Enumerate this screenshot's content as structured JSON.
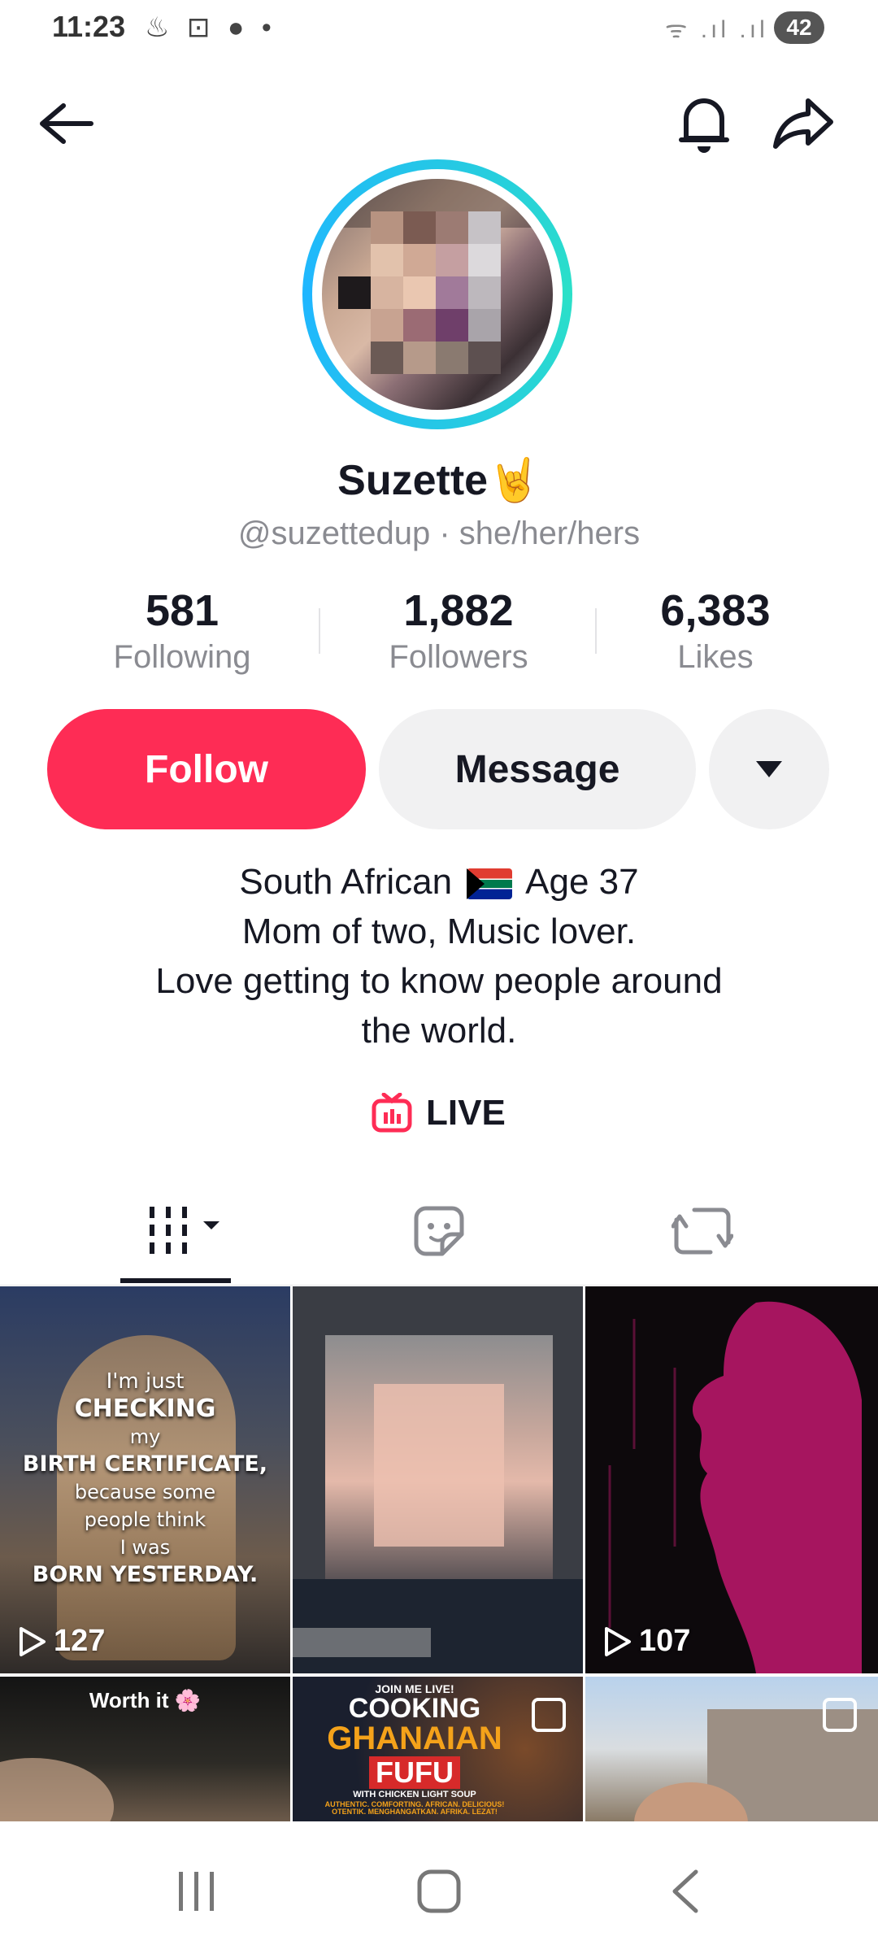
{
  "status_bar": {
    "time": "11:23",
    "icons": "♨ ⊡ ● •",
    "signal": "ᯤ .ıl .ıl",
    "battery": "42"
  },
  "header": {
    "back_icon": "arrow-left",
    "bell_icon": "bell",
    "share_icon": "share-arrow"
  },
  "profile": {
    "display_name": "Suzette",
    "emoji": "🤘",
    "handle": "@suzettedup · she/her/hers",
    "stats": [
      {
        "value": "581",
        "label": "Following"
      },
      {
        "value": "1,882",
        "label": "Followers"
      },
      {
        "value": "6,383",
        "label": "Likes"
      }
    ]
  },
  "actions": {
    "follow": "Follow",
    "message": "Message"
  },
  "bio": {
    "line1_a": "South African",
    "line1_b": "Age 37",
    "line2": "Mom of two, Music lover.",
    "line3": "Love getting to know people around",
    "line4": "the world."
  },
  "live_label": "LIVE",
  "grid": [
    {
      "overlay": [
        "I'm just",
        "CHECKING",
        "my",
        "BIRTH CERTIFICATE,",
        "because some",
        "people think",
        "I was",
        "BORN YESTERDAY."
      ],
      "views": "127"
    },
    {
      "overlay": [],
      "views": ""
    },
    {
      "overlay": [],
      "views": "107"
    },
    {
      "overlay": [
        "Worth it 🌸"
      ],
      "views": ""
    },
    {
      "overlay": [
        "JOIN ME LIVE!",
        "COOKING",
        "GHANAIAN",
        "FUFU",
        "WITH CHICKEN LIGHT SOUP",
        "AUTHENTIC. COMFORTING. AFRICAN. DELICIOUS!",
        "OTENTIK. MENGHANGATKAN. AFRIKA. LEZAT!"
      ],
      "views": ""
    },
    {
      "overlay": [],
      "views": ""
    }
  ],
  "colors": {
    "accent": "#fe2c55",
    "ring": "#25c7e6",
    "text": "#161823",
    "muted": "#8a8b91"
  }
}
